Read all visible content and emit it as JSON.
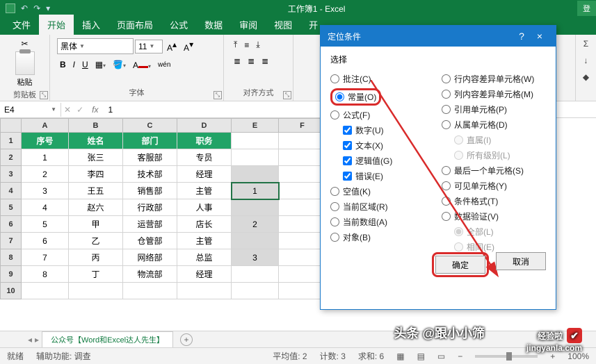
{
  "title": "工作簿1 - Excel",
  "login_btn": "登",
  "tabs": [
    "文件",
    "开始",
    "插入",
    "页面布局",
    "公式",
    "数据",
    "审阅",
    "视图",
    "开"
  ],
  "active_tab": 1,
  "ribbon": {
    "clipboard": {
      "label": "剪贴板",
      "paste": "粘贴"
    },
    "font": {
      "label": "字体",
      "name": "黑体",
      "size": "11",
      "bold": "B",
      "italic": "I",
      "underline": "U",
      "grow": "A",
      "shrink": "A",
      "phonetic": "wén"
    },
    "align": {
      "label": "对齐方式"
    }
  },
  "side": {
    "sum": "Σ",
    "fill": "↓",
    "clear": "◆"
  },
  "namebox": "E4",
  "formula": "1",
  "cols": [
    "A",
    "B",
    "C",
    "D",
    "E",
    "F"
  ],
  "headers": [
    "序号",
    "姓名",
    "部门",
    "职务"
  ],
  "rows": [
    [
      "1",
      "张三",
      "客服部",
      "专员",
      ""
    ],
    [
      "2",
      "李四",
      "技术部",
      "经理",
      ""
    ],
    [
      "3",
      "王五",
      "销售部",
      "主管",
      "1"
    ],
    [
      "4",
      "赵六",
      "行政部",
      "人事",
      ""
    ],
    [
      "5",
      "甲",
      "运营部",
      "店长",
      "2"
    ],
    [
      "6",
      "乙",
      "仓管部",
      "主管",
      ""
    ],
    [
      "7",
      "丙",
      "网络部",
      "总监",
      "3"
    ],
    [
      "8",
      "丁",
      "物流部",
      "经理",
      ""
    ]
  ],
  "sheet_tab": "公众号【Word和Excel达人先生】",
  "status": {
    "ready": "就绪",
    "aux": "辅助功能: 调查",
    "avg": "平均值: 2",
    "count": "计数: 3",
    "sum": "求和: 6",
    "zoom": "100%"
  },
  "dialog": {
    "title": "定位条件",
    "group": "选择",
    "left": [
      {
        "t": "批注(C)",
        "r": true
      },
      {
        "t": "常量(O)",
        "r": true,
        "hl": true,
        "checked": true
      },
      {
        "t": "公式(F)",
        "r": true
      },
      {
        "t": "数字(U)",
        "c": true,
        "sub": true,
        "checked": true
      },
      {
        "t": "文本(X)",
        "c": true,
        "sub": true,
        "checked": true
      },
      {
        "t": "逻辑值(G)",
        "c": true,
        "sub": true,
        "checked": true
      },
      {
        "t": "错误(E)",
        "c": true,
        "sub": true,
        "checked": true
      },
      {
        "t": "空值(K)",
        "r": true
      },
      {
        "t": "当前区域(R)",
        "r": true
      },
      {
        "t": "当前数组(A)",
        "r": true
      },
      {
        "t": "对象(B)",
        "r": true
      }
    ],
    "right": [
      {
        "t": "行内容差异单元格(W)",
        "r": true
      },
      {
        "t": "列内容差异单元格(M)",
        "r": true
      },
      {
        "t": "引用单元格(P)",
        "r": true
      },
      {
        "t": "从属单元格(D)",
        "r": true
      },
      {
        "t": "直属(I)",
        "r": true,
        "sub": true,
        "dis": true,
        "checked": true
      },
      {
        "t": "所有级别(L)",
        "r": true,
        "sub": true,
        "dis": true
      },
      {
        "t": "最后一个单元格(S)",
        "r": true
      },
      {
        "t": "可见单元格(Y)",
        "r": true
      },
      {
        "t": "条件格式(T)",
        "r": true
      },
      {
        "t": "数据验证(V)",
        "r": true
      },
      {
        "t": "全部(L)",
        "r": true,
        "sub": true,
        "dis": true,
        "checked": true
      },
      {
        "t": "相同(E)",
        "r": true,
        "sub": true,
        "dis": true
      }
    ],
    "ok": "确定",
    "cancel": "取消",
    "help": "?",
    "close": "×"
  },
  "wm1": "经验啦",
  "wm1b": "jingyanla.com",
  "wm2": "头条 @跟小小筛"
}
